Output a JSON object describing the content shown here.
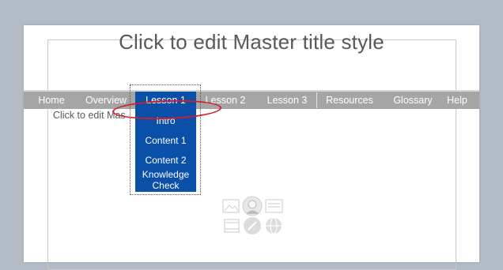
{
  "slide": {
    "master_title": "Click to edit Master title style",
    "content_text": "Click to edit Mas"
  },
  "navbar": {
    "items": [
      {
        "label": "Home"
      },
      {
        "label": "Overview"
      },
      {
        "label": "Lesson 1",
        "active": true
      },
      {
        "label": "Lesson 2"
      },
      {
        "label": "Lesson 3"
      },
      {
        "label": "Resources"
      },
      {
        "label": "Glossary"
      },
      {
        "label": "Help"
      }
    ]
  },
  "dropdown": {
    "items": [
      "Intro",
      "Content 1",
      "Content 2",
      "Knowledge Check"
    ]
  },
  "colors": {
    "navbar_bg": "#a5a5a5",
    "active_blue": "#0a4fa8",
    "highlight_red": "#d11f2a",
    "background": "#b3bcc6"
  },
  "icons": [
    "picture-icon",
    "avatar-icon",
    "text-card-icon",
    "media-icon",
    "edit-icon",
    "globe-icon"
  ]
}
